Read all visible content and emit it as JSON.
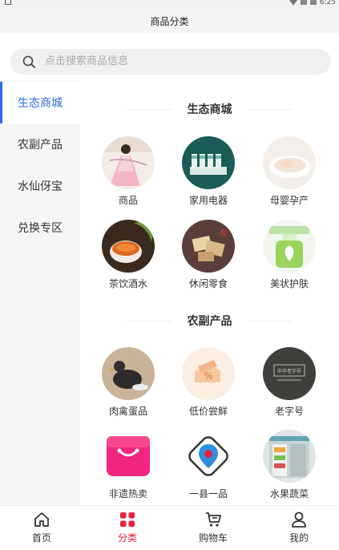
{
  "status_bar": {
    "time": "6:25"
  },
  "header": {
    "title": "商品分类"
  },
  "search": {
    "placeholder": "点击搜索商品信息"
  },
  "sidebar": {
    "items": [
      {
        "label": "生态商城",
        "active": true
      },
      {
        "label": "农副产品",
        "active": false
      },
      {
        "label": "水仙伢宝",
        "active": false
      },
      {
        "label": "兑换专区",
        "active": false
      }
    ]
  },
  "sections": [
    {
      "title": "生态商城",
      "items": [
        {
          "label": "商品"
        },
        {
          "label": "家用电器"
        },
        {
          "label": "母婴孕产"
        },
        {
          "label": "茶饮酒水"
        },
        {
          "label": "休闲零食"
        },
        {
          "label": "美状护肤"
        }
      ]
    },
    {
      "title": "农副产品",
      "items": [
        {
          "label": "肉禽蛋品"
        },
        {
          "label": "低价尝鲜"
        },
        {
          "label": "老字号"
        },
        {
          "label": "非遗热卖"
        },
        {
          "label": "一县一品"
        },
        {
          "label": "水果蔬菜"
        }
      ]
    }
  ],
  "thumb_text": {
    "discount": "%",
    "laozihao": "中华老字号"
  },
  "tabbar": {
    "items": [
      {
        "label": "首页",
        "icon": "home-icon",
        "active": false
      },
      {
        "label": "分类",
        "icon": "category-icon",
        "active": true
      },
      {
        "label": "购物车",
        "icon": "cart-icon",
        "active": false
      },
      {
        "label": "我的",
        "icon": "user-icon",
        "active": false
      }
    ]
  },
  "colors": {
    "accent": "#2f6be4",
    "tab_active": "#e8213f"
  }
}
